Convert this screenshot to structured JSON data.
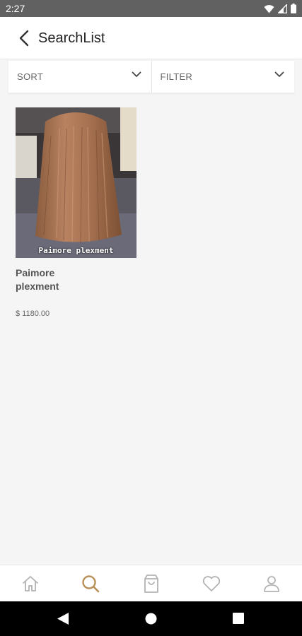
{
  "status_bar": {
    "time": "2:27",
    "icons": [
      "wifi-icon",
      "cellular-icon",
      "battery-icon"
    ]
  },
  "app_bar": {
    "title": "SearchList",
    "back_icon": "back-arrow-icon"
  },
  "filter_bar": {
    "sort_label": "SORT",
    "filter_label": "FILTER"
  },
  "products": [
    {
      "name": "Paimore plexment",
      "price": "$ 1180.00",
      "image_caption": "Paimore plexment"
    }
  ],
  "bottom_nav": {
    "items": [
      {
        "icon": "home-icon",
        "active": false
      },
      {
        "icon": "search-icon",
        "active": true
      },
      {
        "icon": "shopping-bag-icon",
        "active": false
      },
      {
        "icon": "heart-icon",
        "active": false
      },
      {
        "icon": "profile-icon",
        "active": false
      }
    ]
  },
  "colors": {
    "accent": "#b8915a",
    "inactive_icon": "#b3b3b3",
    "background": "#f5f5f5",
    "status_bar": "#616161"
  }
}
